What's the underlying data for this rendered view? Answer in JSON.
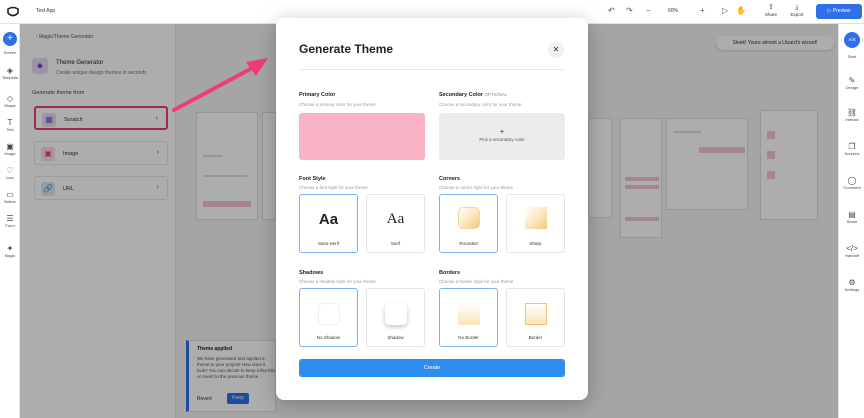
{
  "app": {
    "title": "Test App"
  },
  "topbar": {
    "zoom": "60%",
    "share_label": "Share",
    "export_label": "Export",
    "preview_label": "Preview"
  },
  "left_rail": {
    "items": [
      {
        "label": "Screen",
        "icon": "plus-icon"
      },
      {
        "label": "Template",
        "icon": "stack-icon"
      },
      {
        "label": "Shape",
        "icon": "shape-icon"
      },
      {
        "label": "Text",
        "icon": "text-icon"
      },
      {
        "label": "Image",
        "icon": "image-icon"
      },
      {
        "label": "Icon",
        "icon": "heart-icon"
      },
      {
        "label": "Button",
        "icon": "button-icon"
      },
      {
        "label": "Form",
        "icon": "form-icon"
      },
      {
        "label": "Magic",
        "icon": "magic-icon"
      }
    ]
  },
  "panel": {
    "breadcrumb": "Magic/Theme Generator",
    "title": "Theme Generator",
    "subtitle": "Create unique design themes in seconds",
    "generate_label": "Generate theme from",
    "options": [
      {
        "label": "Scratch",
        "icon": "grid-icon",
        "color": "#7b4ed1",
        "bg": "#e6dcf5"
      },
      {
        "label": "Image",
        "icon": "image-icon",
        "color": "#e0457b",
        "bg": "#fbdde6"
      },
      {
        "label": "URL",
        "icon": "link-icon",
        "color": "#2f6fe8",
        "bg": "#dde8fb"
      }
    ]
  },
  "toast": {
    "title": "Theme applied",
    "body": "We have generated and applied a theme to your project! How does it look? You can decide to keep it like this or revert to the previous theme",
    "revert_label": "Revert",
    "keep_label": "Keep"
  },
  "right_rail": {
    "avatar": "A/S",
    "items": [
      "Start",
      "Design",
      "Interact",
      "Screens",
      "Comment",
      "Share",
      "Handoff",
      "Settings"
    ]
  },
  "bubble": "Sleek! Youre almost a Uizard's wizard!",
  "modal": {
    "title": "Generate Theme",
    "primary": {
      "title": "Primary Color",
      "sub": "Choose a primary color for your theme",
      "color": "#f8b4c4"
    },
    "secondary": {
      "title": "Secondary Color",
      "optional": "OPTIONAL",
      "sub": "Choose a secondary color for your theme",
      "pick_label": "Pick a secondary color"
    },
    "font_style": {
      "title": "Font Style",
      "sub": "Choose a font style for your theme",
      "sample": "Aa",
      "options": [
        "Sans-Serif",
        "Serif"
      ]
    },
    "corners": {
      "title": "Corners",
      "sub": "Choose a corner style for your theme",
      "options": [
        "Rounded",
        "Sharp"
      ]
    },
    "shadows": {
      "title": "Shadows",
      "sub": "Choose a shadow style for your theme",
      "options": [
        "No Shadow",
        "Shadow"
      ]
    },
    "borders": {
      "title": "Borders",
      "sub": "Choose a border style for your theme",
      "options": [
        "No Border",
        "Border"
      ]
    },
    "create_label": "Create"
  },
  "colors": {
    "accent": "#2f8df0",
    "highlight": "#ee3d74"
  }
}
